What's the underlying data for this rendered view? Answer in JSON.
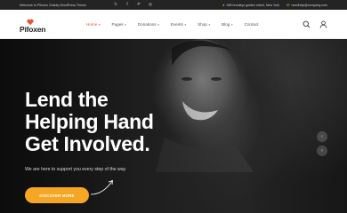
{
  "topbar": {
    "welcome": "Welcome to Pifoxen Charity WordPress Theme",
    "socials": [
      {
        "icon": "twitter-icon",
        "glyph": "𝕏"
      },
      {
        "icon": "facebook-icon",
        "glyph": "f"
      },
      {
        "icon": "pinterest-icon",
        "glyph": "P"
      },
      {
        "icon": "instagram-icon",
        "glyph": "◎"
      }
    ],
    "address": "256 brooklyn golden street, New York",
    "email": "needhelp@company.com"
  },
  "header": {
    "logo_text": "Pifoxen",
    "nav": [
      {
        "label": "Home",
        "active": true
      },
      {
        "label": "Pages",
        "active": false
      },
      {
        "label": "Donations",
        "active": false
      },
      {
        "label": "Events",
        "active": false
      },
      {
        "label": "Shop",
        "active": false
      },
      {
        "label": "Blog",
        "active": false
      },
      {
        "label": "Contact",
        "active": false
      }
    ]
  },
  "hero": {
    "title_line1": "Lend the",
    "title_line2": "Helping Hand",
    "title_line3": "Get Involved.",
    "subtitle": "We are here to support you every step of the way",
    "cta_label": "DISCOVER MORE",
    "prev_glyph": "‹",
    "next_glyph": "›"
  },
  "colors": {
    "accent": "#e8542f",
    "button": "#f5a623",
    "topbar_bg": "#242424"
  }
}
